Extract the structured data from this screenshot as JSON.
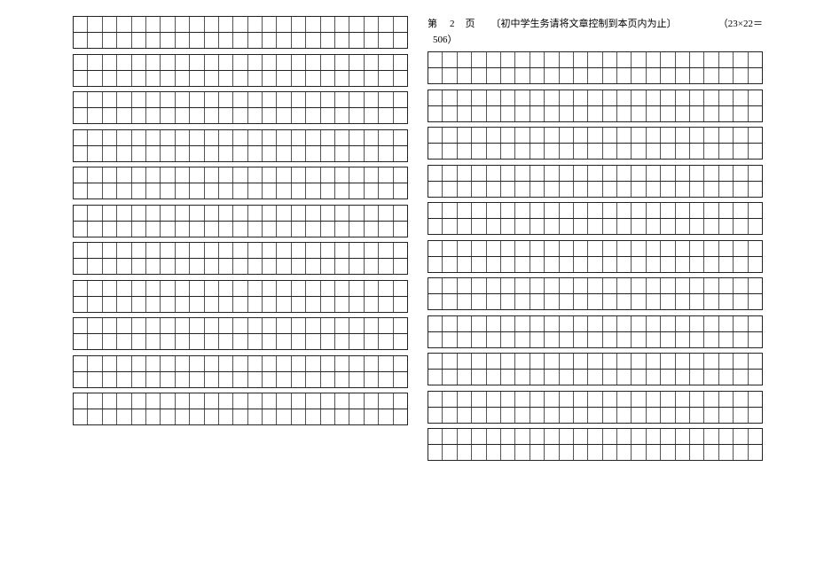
{
  "left_grid": {
    "columns": 23,
    "groups": 11,
    "rows_per_group": 2
  },
  "right_header": {
    "page_prefix": "第",
    "page_num": "2",
    "page_suffix": "页",
    "note": "〔初中学生务请将文章控制到本页内为止〕",
    "formula": "（23×22＝"
  },
  "right_count": "506）",
  "right_grid": {
    "columns": 23,
    "groups": 11,
    "rows_per_group": 2
  }
}
